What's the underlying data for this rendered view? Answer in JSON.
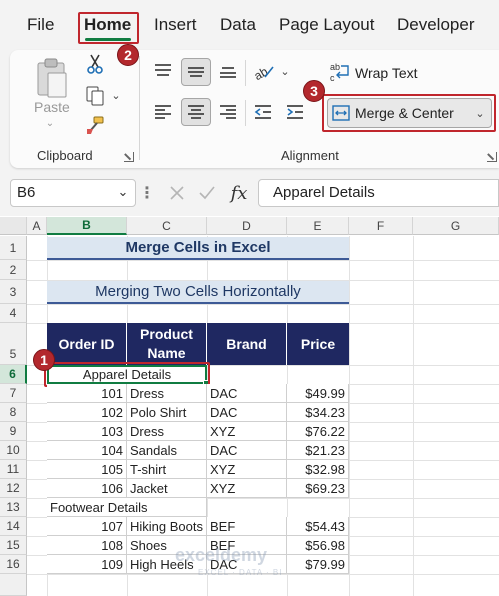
{
  "ribbon_tabs": [
    "File",
    "Home",
    "Insert",
    "Data",
    "Page Layout",
    "Developer"
  ],
  "active_tab": "Home",
  "clipboard": {
    "paste_label": "Paste",
    "group_label": "Clipboard"
  },
  "alignment": {
    "wrap_text_label": "Wrap Text",
    "merge_center_label": "Merge & Center",
    "group_label": "Alignment"
  },
  "badges": [
    "1",
    "2",
    "3"
  ],
  "formula_bar": {
    "name_box": "B6",
    "fx": "fx",
    "formula": "Apparel Details"
  },
  "columns": [
    "A",
    "B",
    "C",
    "D",
    "E",
    "F",
    "G"
  ],
  "selected_column": "B",
  "rows": [
    "1",
    "2",
    "3",
    "4",
    "5",
    "6",
    "7",
    "8",
    "9",
    "10",
    "11",
    "12",
    "13",
    "14",
    "15",
    "16"
  ],
  "selected_row": "6",
  "sheet": {
    "title": "Merge Cells in Excel",
    "subtitle": "Merging Two Cells Horizontally",
    "headers": [
      "Order ID",
      "Product Name",
      "Brand",
      "Price"
    ],
    "group1_label": "Apparel Details",
    "group1_rows": [
      {
        "id": "101",
        "product": "Dress",
        "brand": "DAC",
        "price": "$49.99"
      },
      {
        "id": "102",
        "product": "Polo Shirt",
        "brand": "DAC",
        "price": "$34.23"
      },
      {
        "id": "103",
        "product": "Dress",
        "brand": "XYZ",
        "price": "$76.22"
      },
      {
        "id": "104",
        "product": "Sandals",
        "brand": "DAC",
        "price": "$21.23"
      },
      {
        "id": "105",
        "product": "T-shirt",
        "brand": "XYZ",
        "price": "$32.98"
      },
      {
        "id": "106",
        "product": "Jacket",
        "brand": "XYZ",
        "price": "$69.23"
      }
    ],
    "group2_label": "Footwear Details",
    "group2_rows": [
      {
        "id": "107",
        "product": "Hiking Boots",
        "brand": "BEF",
        "price": "$54.43"
      },
      {
        "id": "108",
        "product": "Shoes",
        "brand": "BEF",
        "price": "$56.98"
      },
      {
        "id": "109",
        "product": "High Heels",
        "brand": "DAC",
        "price": "$79.99"
      }
    ]
  },
  "watermark": {
    "brand": "exceldemy",
    "tagline": "EXCEL · DATA · BI"
  },
  "colors": {
    "accent_green": "#107c41",
    "header_navy": "#1f2861",
    "title_fill": "#dce6f1",
    "callout_red": "#c0262d"
  }
}
